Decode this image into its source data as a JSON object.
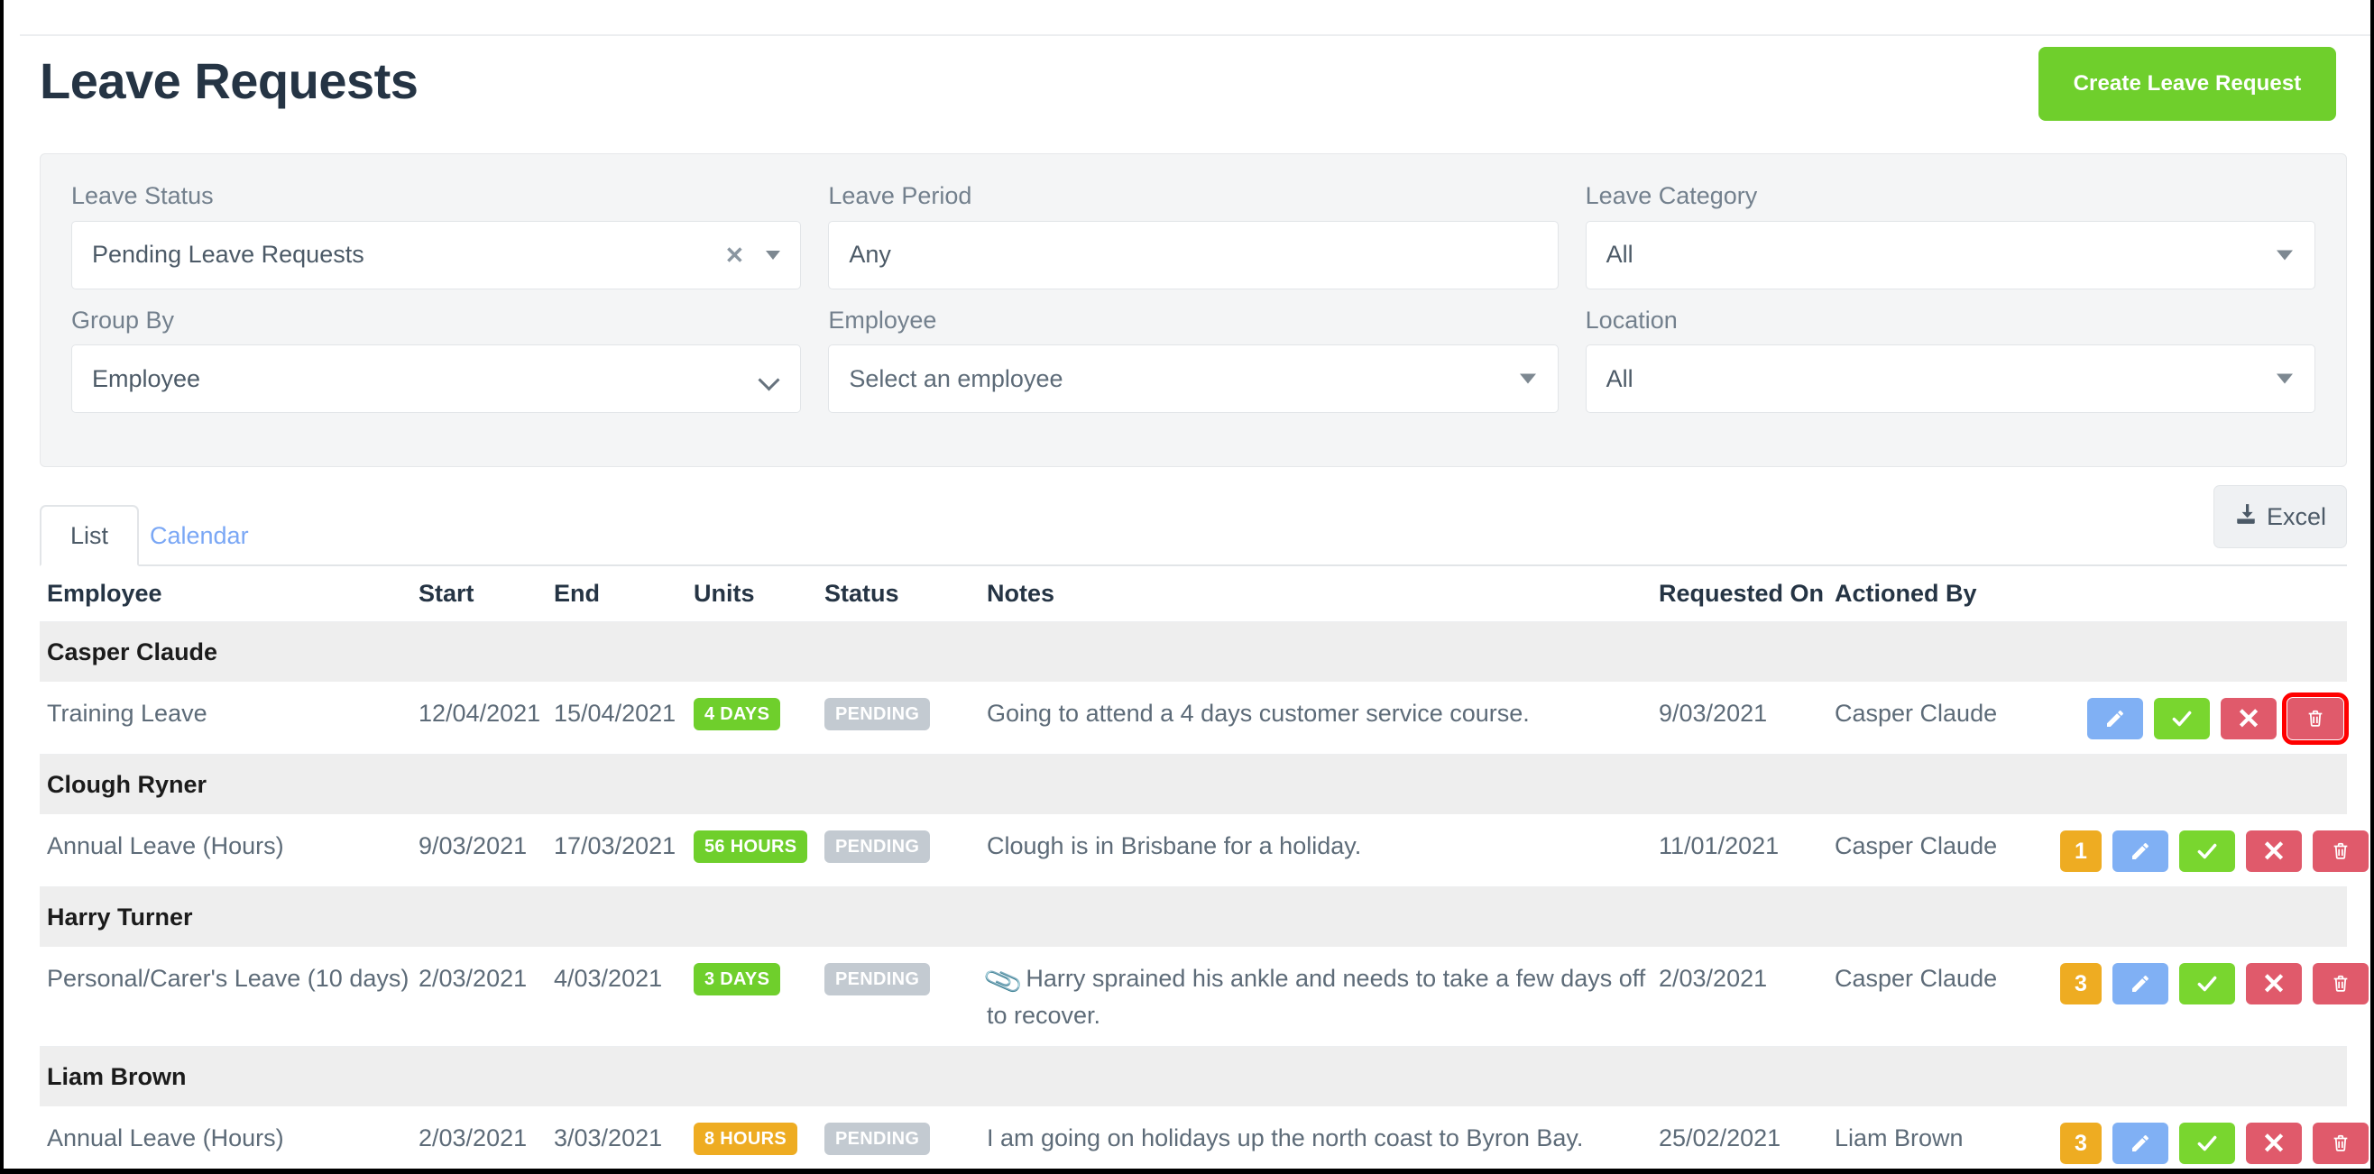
{
  "header": {
    "title": "Leave Requests",
    "create_button": "Create Leave Request"
  },
  "filters": {
    "leave_status": {
      "label": "Leave Status",
      "value": "Pending Leave Requests",
      "clear": "✕"
    },
    "leave_period": {
      "label": "Leave Period",
      "value": "Any"
    },
    "leave_category": {
      "label": "Leave Category",
      "value": "All"
    },
    "group_by": {
      "label": "Group By",
      "value": "Employee"
    },
    "employee": {
      "label": "Employee",
      "value": "Select an employee"
    },
    "location": {
      "label": "Location",
      "value": "All"
    }
  },
  "tabs": {
    "list": "List",
    "calendar": "Calendar",
    "excel": "Excel"
  },
  "table": {
    "columns": {
      "employee": "Employee",
      "start": "Start",
      "end": "End",
      "units": "Units",
      "status": "Status",
      "notes": "Notes",
      "requested_on": "Requested On",
      "actioned_by": "Actioned By"
    },
    "groups": [
      {
        "name": "Casper Claude",
        "rows": [
          {
            "leave_type": "Training Leave",
            "start": "12/04/2021",
            "end": "15/04/2021",
            "units": "4 DAYS",
            "units_color": "green",
            "status": "PENDING",
            "has_attachment": false,
            "notes": "Going to attend a 4 days customer service course.",
            "requested_on": "9/03/2021",
            "actioned_by": "Casper Claude",
            "count": null,
            "delete_highlighted": true
          }
        ]
      },
      {
        "name": "Clough Ryner",
        "rows": [
          {
            "leave_type": "Annual Leave (Hours)",
            "start": "9/03/2021",
            "end": "17/03/2021",
            "units": "56 HOURS",
            "units_color": "green",
            "status": "PENDING",
            "has_attachment": false,
            "notes": "Clough is in Brisbane for a holiday.",
            "requested_on": "11/01/2021",
            "actioned_by": "Casper Claude",
            "count": "1",
            "delete_highlighted": false
          }
        ]
      },
      {
        "name": "Harry Turner",
        "rows": [
          {
            "leave_type": "Personal/Carer's Leave (10 days)",
            "start": "2/03/2021",
            "end": "4/03/2021",
            "units": "3 DAYS",
            "units_color": "green",
            "status": "PENDING",
            "has_attachment": true,
            "notes": "Harry sprained his ankle and needs to take a few days off to recover.",
            "requested_on": "2/03/2021",
            "actioned_by": "Casper Claude",
            "count": "3",
            "delete_highlighted": false
          }
        ]
      },
      {
        "name": "Liam Brown",
        "rows": [
          {
            "leave_type": "Annual Leave (Hours)",
            "start": "2/03/2021",
            "end": "3/03/2021",
            "units": "8 HOURS",
            "units_color": "orange",
            "status": "PENDING",
            "has_attachment": false,
            "notes": "I am going on holidays up the north coast to Byron Bay.",
            "requested_on": "25/02/2021",
            "actioned_by": "Liam Brown",
            "count": "3",
            "delete_highlighted": false
          }
        ]
      }
    ]
  },
  "colors": {
    "brand_green": "#6fcf2c",
    "orange": "#eeac22",
    "status_grey": "#c3cad1",
    "edit_blue": "#80b0f4",
    "danger_red": "#e05a6b",
    "highlight_red": "#ff0000",
    "link_blue": "#7aa7f5"
  }
}
